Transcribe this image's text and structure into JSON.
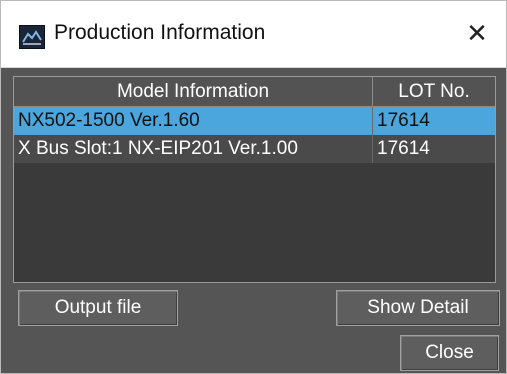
{
  "window": {
    "title": "Production Information",
    "close_glyph": "✕",
    "icon": "production-info-icon"
  },
  "table": {
    "columns": [
      "Model Information",
      "LOT No."
    ],
    "rows": [
      {
        "model": "NX502-1500 Ver.1.60",
        "lot": "17614",
        "selected": true
      },
      {
        "model": "X Bus Slot:1 NX-EIP201 Ver.1.00",
        "lot": "17614",
        "selected": false
      }
    ]
  },
  "buttons": {
    "output_file": "Output file",
    "show_detail": "Show Detail",
    "close": "Close"
  },
  "colors": {
    "dialog_background": "#555555",
    "selected_row": "#4aa6dd",
    "header_background": "#535353"
  }
}
